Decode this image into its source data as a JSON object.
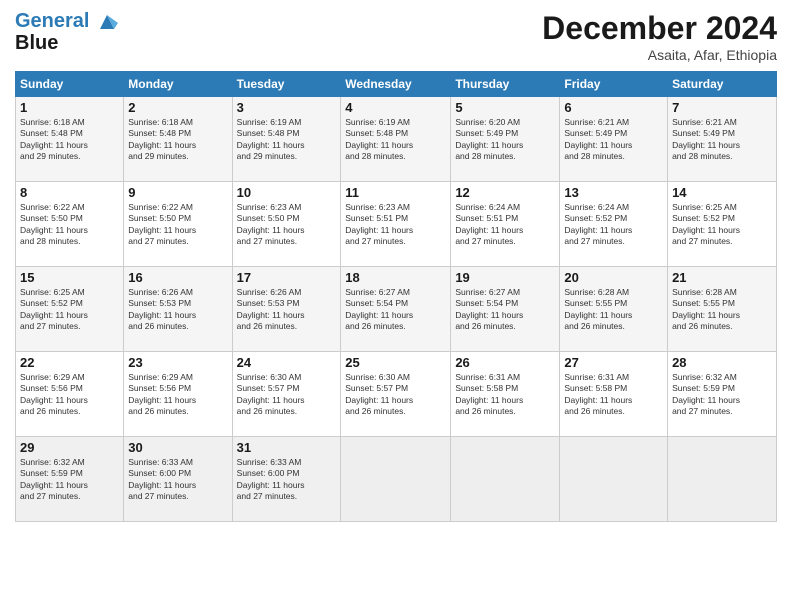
{
  "header": {
    "logo_line1": "General",
    "logo_line2": "Blue",
    "title": "December 2024",
    "location": "Asaita, Afar, Ethiopia"
  },
  "columns": [
    "Sunday",
    "Monday",
    "Tuesday",
    "Wednesday",
    "Thursday",
    "Friday",
    "Saturday"
  ],
  "rows": [
    [
      {
        "day": "1",
        "info": "Sunrise: 6:18 AM\nSunset: 5:48 PM\nDaylight: 11 hours\nand 29 minutes."
      },
      {
        "day": "2",
        "info": "Sunrise: 6:18 AM\nSunset: 5:48 PM\nDaylight: 11 hours\nand 29 minutes."
      },
      {
        "day": "3",
        "info": "Sunrise: 6:19 AM\nSunset: 5:48 PM\nDaylight: 11 hours\nand 29 minutes."
      },
      {
        "day": "4",
        "info": "Sunrise: 6:19 AM\nSunset: 5:48 PM\nDaylight: 11 hours\nand 28 minutes."
      },
      {
        "day": "5",
        "info": "Sunrise: 6:20 AM\nSunset: 5:49 PM\nDaylight: 11 hours\nand 28 minutes."
      },
      {
        "day": "6",
        "info": "Sunrise: 6:21 AM\nSunset: 5:49 PM\nDaylight: 11 hours\nand 28 minutes."
      },
      {
        "day": "7",
        "info": "Sunrise: 6:21 AM\nSunset: 5:49 PM\nDaylight: 11 hours\nand 28 minutes."
      }
    ],
    [
      {
        "day": "8",
        "info": "Sunrise: 6:22 AM\nSunset: 5:50 PM\nDaylight: 11 hours\nand 28 minutes."
      },
      {
        "day": "9",
        "info": "Sunrise: 6:22 AM\nSunset: 5:50 PM\nDaylight: 11 hours\nand 27 minutes."
      },
      {
        "day": "10",
        "info": "Sunrise: 6:23 AM\nSunset: 5:50 PM\nDaylight: 11 hours\nand 27 minutes."
      },
      {
        "day": "11",
        "info": "Sunrise: 6:23 AM\nSunset: 5:51 PM\nDaylight: 11 hours\nand 27 minutes."
      },
      {
        "day": "12",
        "info": "Sunrise: 6:24 AM\nSunset: 5:51 PM\nDaylight: 11 hours\nand 27 minutes."
      },
      {
        "day": "13",
        "info": "Sunrise: 6:24 AM\nSunset: 5:52 PM\nDaylight: 11 hours\nand 27 minutes."
      },
      {
        "day": "14",
        "info": "Sunrise: 6:25 AM\nSunset: 5:52 PM\nDaylight: 11 hours\nand 27 minutes."
      }
    ],
    [
      {
        "day": "15",
        "info": "Sunrise: 6:25 AM\nSunset: 5:52 PM\nDaylight: 11 hours\nand 27 minutes."
      },
      {
        "day": "16",
        "info": "Sunrise: 6:26 AM\nSunset: 5:53 PM\nDaylight: 11 hours\nand 26 minutes."
      },
      {
        "day": "17",
        "info": "Sunrise: 6:26 AM\nSunset: 5:53 PM\nDaylight: 11 hours\nand 26 minutes."
      },
      {
        "day": "18",
        "info": "Sunrise: 6:27 AM\nSunset: 5:54 PM\nDaylight: 11 hours\nand 26 minutes."
      },
      {
        "day": "19",
        "info": "Sunrise: 6:27 AM\nSunset: 5:54 PM\nDaylight: 11 hours\nand 26 minutes."
      },
      {
        "day": "20",
        "info": "Sunrise: 6:28 AM\nSunset: 5:55 PM\nDaylight: 11 hours\nand 26 minutes."
      },
      {
        "day": "21",
        "info": "Sunrise: 6:28 AM\nSunset: 5:55 PM\nDaylight: 11 hours\nand 26 minutes."
      }
    ],
    [
      {
        "day": "22",
        "info": "Sunrise: 6:29 AM\nSunset: 5:56 PM\nDaylight: 11 hours\nand 26 minutes."
      },
      {
        "day": "23",
        "info": "Sunrise: 6:29 AM\nSunset: 5:56 PM\nDaylight: 11 hours\nand 26 minutes."
      },
      {
        "day": "24",
        "info": "Sunrise: 6:30 AM\nSunset: 5:57 PM\nDaylight: 11 hours\nand 26 minutes."
      },
      {
        "day": "25",
        "info": "Sunrise: 6:30 AM\nSunset: 5:57 PM\nDaylight: 11 hours\nand 26 minutes."
      },
      {
        "day": "26",
        "info": "Sunrise: 6:31 AM\nSunset: 5:58 PM\nDaylight: 11 hours\nand 26 minutes."
      },
      {
        "day": "27",
        "info": "Sunrise: 6:31 AM\nSunset: 5:58 PM\nDaylight: 11 hours\nand 26 minutes."
      },
      {
        "day": "28",
        "info": "Sunrise: 6:32 AM\nSunset: 5:59 PM\nDaylight: 11 hours\nand 27 minutes."
      }
    ],
    [
      {
        "day": "29",
        "info": "Sunrise: 6:32 AM\nSunset: 5:59 PM\nDaylight: 11 hours\nand 27 minutes."
      },
      {
        "day": "30",
        "info": "Sunrise: 6:33 AM\nSunset: 6:00 PM\nDaylight: 11 hours\nand 27 minutes."
      },
      {
        "day": "31",
        "info": "Sunrise: 6:33 AM\nSunset: 6:00 PM\nDaylight: 11 hours\nand 27 minutes."
      },
      {
        "day": "",
        "info": ""
      },
      {
        "day": "",
        "info": ""
      },
      {
        "day": "",
        "info": ""
      },
      {
        "day": "",
        "info": ""
      }
    ]
  ]
}
